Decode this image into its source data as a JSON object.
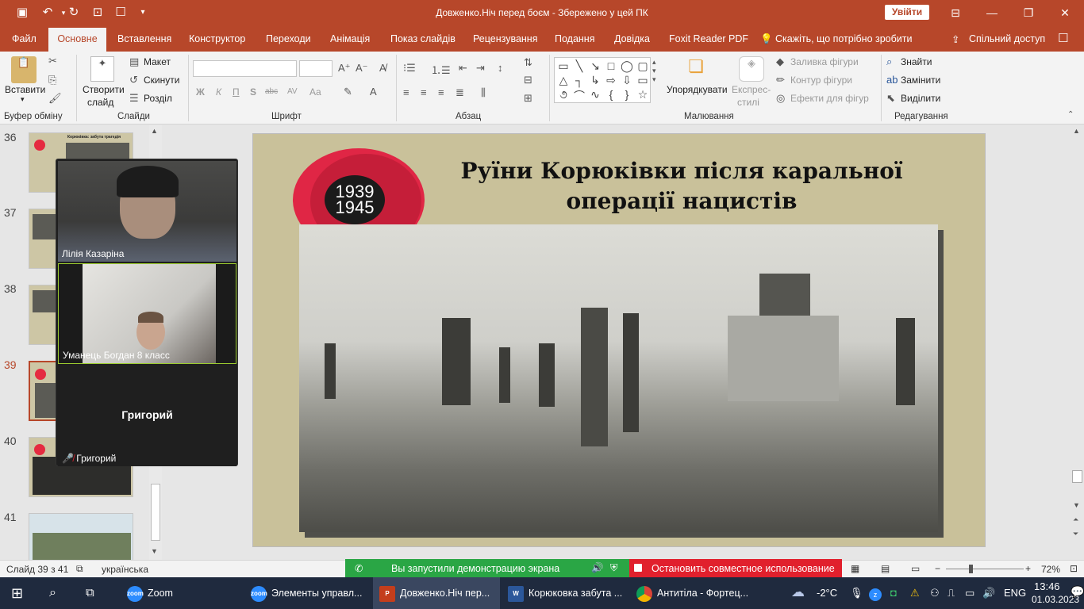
{
  "titlebar": {
    "document_title": "Довженко.Ніч перед боєм - Збережено у цей ПК",
    "sign_in": "Увійти"
  },
  "menu": {
    "tabs": [
      "Файл",
      "Основне",
      "Вставлення",
      "Конструктор",
      "Переходи",
      "Анімація",
      "Показ слайдів",
      "Рецензування",
      "Подання",
      "Довідка",
      "Foxit Reader PDF"
    ],
    "active_tab": "Основне",
    "tell_me": "Скажіть, що потрібно зробити",
    "share": "Спільний доступ"
  },
  "ribbon": {
    "clipboard": {
      "paste": "Вставити",
      "group": "Буфер обміну"
    },
    "slides": {
      "new_slide_1": "Створити",
      "new_slide_2": "слайд",
      "layout": "Макет",
      "reset": "Скинути",
      "section": "Розділ",
      "group": "Слайди"
    },
    "font": {
      "bold": "Ж",
      "italic": "К",
      "underline": "П",
      "shadow": "S",
      "strike": "abc",
      "spacing": "AV",
      "case": "Aa",
      "group": "Шрифт"
    },
    "paragraph": {
      "group": "Абзац"
    },
    "drawing": {
      "arrange": "Упорядкувати",
      "quick_styles_1": "Експрес-",
      "quick_styles_2": "стилі",
      "fill": "Заливка фігури",
      "outline": "Контур фігури",
      "effects": "Ефекти для фігур",
      "group": "Малювання"
    },
    "editing": {
      "find": "Знайти",
      "replace": "Замінити",
      "select": "Виділити",
      "group": "Редагування"
    }
  },
  "thumbnails": [
    {
      "number": "36",
      "title": "Корюківка: забута трагедія"
    },
    {
      "number": "37"
    },
    {
      "number": "38"
    },
    {
      "number": "39"
    },
    {
      "number": "40"
    },
    {
      "number": "41"
    }
  ],
  "slide": {
    "badge_top": "1939",
    "badge_bottom": "1945",
    "title_line1": "Руїни Корюківки після каральної",
    "title_line2": "операції нацистів"
  },
  "zoom": {
    "participants": [
      {
        "name": "Лілія Казаріна"
      },
      {
        "name": "Уманець Богдан 8 класс"
      },
      {
        "name": "Григорий",
        "label": "Григорий"
      }
    ]
  },
  "statusbar": {
    "slide_info": "Слайд 39 з 41",
    "language": "українська",
    "zoom_level": "72%",
    "share_active": "Вы запустили демонстрацию экрана",
    "stop_share": "Остановить совместное использование"
  },
  "taskbar": {
    "apps": [
      "Zoom",
      "Элементы управл...",
      "Довженко.Ніч пер...",
      "Корюковка забута ...",
      "Антитіла - Фортец..."
    ],
    "weather": "-2°C",
    "lang": "ENG",
    "time": "13:46",
    "date": "01.03.2023"
  },
  "colors": {
    "accent": "#b7472a",
    "zoom_green": "#2aa645",
    "zoom_red": "#e1202d",
    "poppy": "#e02645"
  }
}
